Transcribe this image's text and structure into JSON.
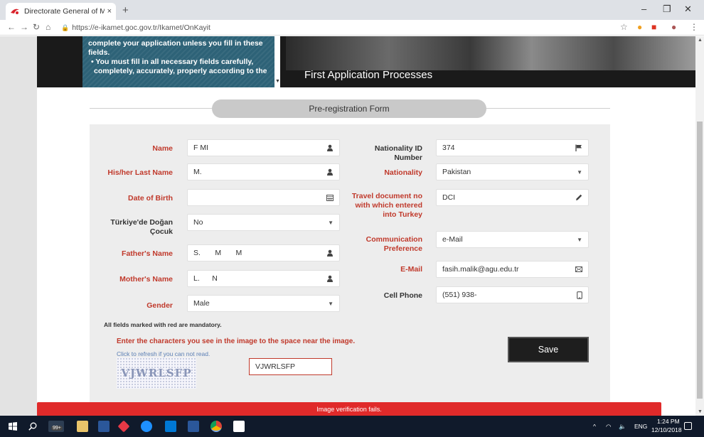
{
  "browser": {
    "tab_title": "Directorate General of Migration",
    "tab_close": "×",
    "new_tab": "+",
    "url": "https://e-ikamet.goc.gov.tr/Ikamet/OnKayit",
    "window_controls": [
      "–",
      "❐",
      "✕"
    ]
  },
  "header": {
    "notice_lines": [
      "complete your application unless you fill in these",
      "fields.",
      "• You must fill in all necessary fields carefully,",
      "completely, accurately, properly according to the"
    ],
    "banner_title": "First Application Processes"
  },
  "form": {
    "title": "Pre-registration Form",
    "left": [
      {
        "label": "Name",
        "value": "F    MI",
        "icon": "person-icon"
      },
      {
        "label": "His/her Last Name",
        "value": "M.",
        "icon": "person-icon"
      },
      {
        "label": "Date of Birth",
        "value": "",
        "icon": "calendar-icon"
      },
      {
        "label": "Türkiye'de Doğan Çocuk",
        "value": "No",
        "icon": "dropdown-icon"
      },
      {
        "label": "Father's Name",
        "value": "S.       M       M",
        "icon": "person-icon"
      },
      {
        "label": "Mother's Name",
        "value": "L.      N",
        "icon": "person-icon"
      },
      {
        "label": "Gender",
        "value": "Male",
        "icon": "dropdown-icon"
      }
    ],
    "right": [
      {
        "label": "Nationality ID Number",
        "value": "374",
        "icon": "flag-icon"
      },
      {
        "label": "Nationality",
        "value": "Pakistan",
        "icon": "dropdown-icon"
      },
      {
        "label": "Travel document no with which entered into Turkey",
        "value": "DCI",
        "icon": "pencil-icon"
      },
      {
        "label": "Communication Preference",
        "value": "e-Mail",
        "icon": "dropdown-icon"
      },
      {
        "label": "E-Mail",
        "value": "fasih.malik@agu.edu.tr",
        "icon": "envelope-icon"
      },
      {
        "label": "Cell Phone",
        "value": "(551) 938-",
        "icon": "phone-icon"
      }
    ],
    "mandatory_note": "All fields marked with red are mandatory.",
    "captcha_instruction": "Enter the characters you see in the image to the space near the image.",
    "captcha_refresh": "Click to refresh if you can not read.",
    "captcha_image_text": "VJWRLSFP",
    "captcha_value": "VJWRLSFP",
    "save_label": "Save"
  },
  "error_message": "Image verification fails.",
  "taskbar": {
    "time": "1:24 PM",
    "date": "12/10/2018",
    "lang": "ENG",
    "badge": "99+"
  },
  "colors": {
    "label_red": "#c0392b",
    "notice_bg": "#2d6277",
    "error_red": "#e02a2a",
    "taskbar_bg": "#101a2b"
  }
}
